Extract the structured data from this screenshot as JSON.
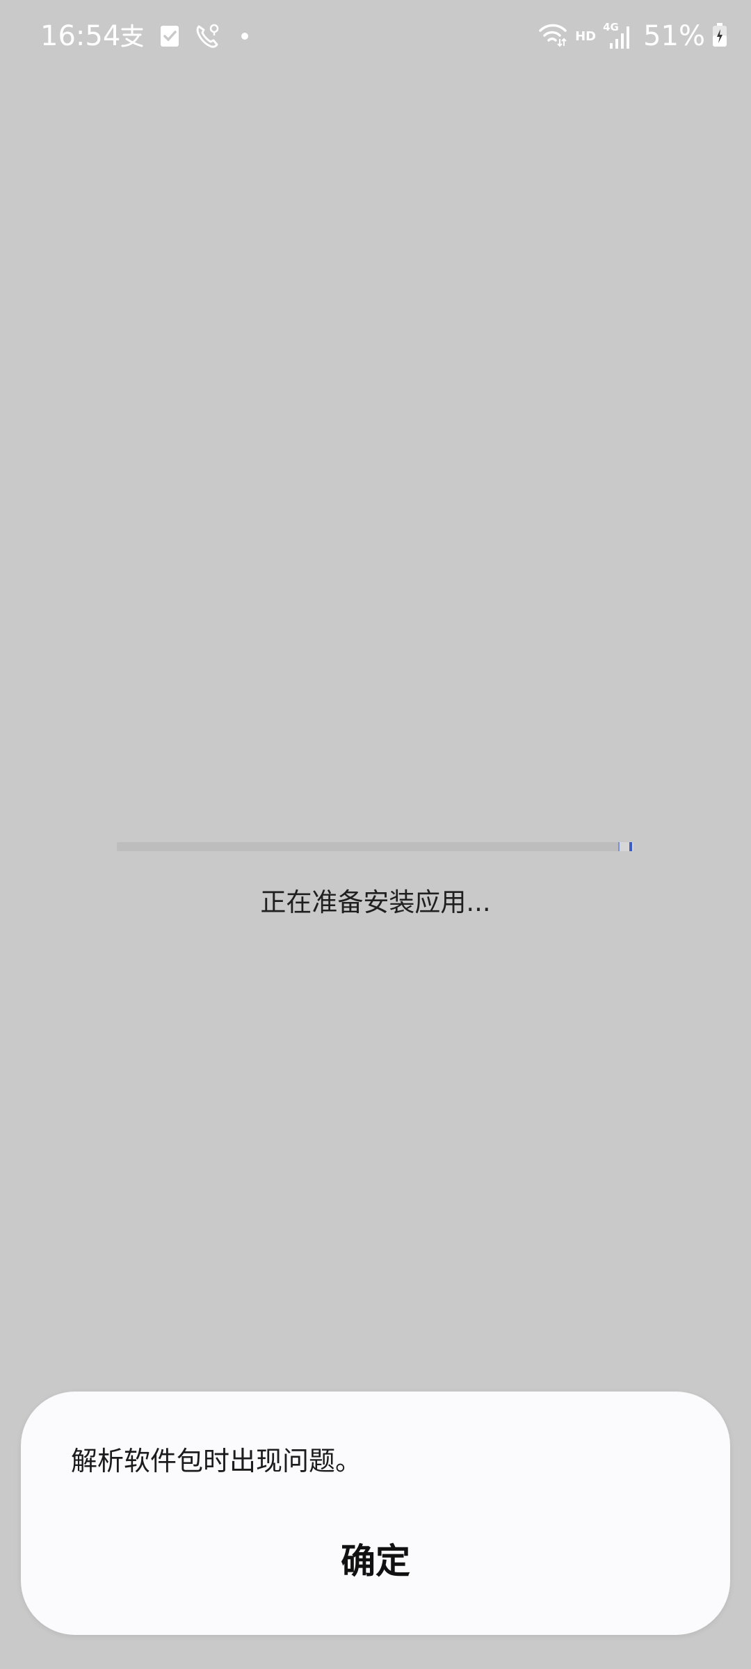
{
  "status_bar": {
    "time": "16:54",
    "battery": "51%",
    "network_badge": "HD",
    "signal_badge": "4G",
    "left_icons": [
      "alipay-icon",
      "task-check-icon",
      "phone-location-icon",
      "dot-icon"
    ],
    "right_icons": [
      "wifi-icon",
      "cellular-signal-icon",
      "battery-charging-icon"
    ]
  },
  "install": {
    "progress_label": "正在准备安装应用...",
    "progress_fraction": 0.97,
    "accent_color": "#3f5bc4"
  },
  "dialog": {
    "message": "解析软件包时出现问题。",
    "confirm_label": "确定"
  }
}
